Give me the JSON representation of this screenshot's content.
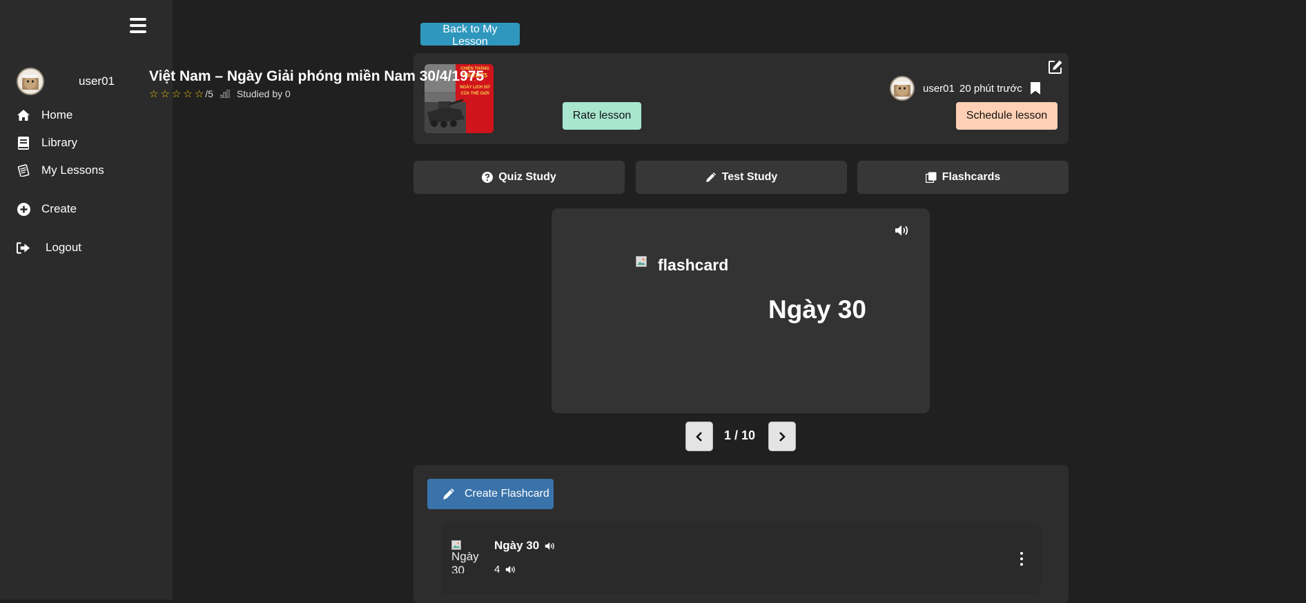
{
  "sidebar": {
    "username": "user01",
    "items": [
      {
        "label": "Home",
        "icon": "home-icon"
      },
      {
        "label": "Library",
        "icon": "book-icon"
      },
      {
        "label": "My Lessons",
        "icon": "notepad-icon"
      },
      {
        "label": "Create",
        "icon": "plus-circle-icon"
      },
      {
        "label": "Logout",
        "icon": "logout-icon"
      }
    ]
  },
  "back_button_label": "Back to My Lesson",
  "lesson": {
    "title": "Việt Nam – Ngày Giải phóng miền Nam 30/4/1975",
    "rating_max": "/5",
    "rating_value": 0,
    "studied": "Studied by 0",
    "rate_label": "Rate lesson",
    "schedule_label": "Schedule lesson",
    "owner": "user01",
    "time_ago": "20 phút trước",
    "thumbnail_lines": [
      "CHIẾN THẮNG",
      "30/4/1975",
      "-",
      "NGÀY LỊCH SỬ",
      "CỦA THẾ GIỚI"
    ]
  },
  "modes": [
    {
      "label": "Quiz Study",
      "icon": "question-circle-icon"
    },
    {
      "label": "Test Study",
      "icon": "pencil-icon"
    },
    {
      "label": "Flashcards",
      "icon": "cards-icon"
    }
  ],
  "flashcard": {
    "image_alt": "flashcard",
    "term": "Ngày 30",
    "counter": "1 / 10"
  },
  "create_flashcard_label": "Create Flashcard",
  "flashcard_list": [
    {
      "image_alt": "Ngày 30",
      "term": "Ngày 30",
      "definition": "4"
    }
  ],
  "colors": {
    "sidebar_bg": "#2b2b2b",
    "page_bg": "#202020",
    "back_button": "#2f97bd",
    "rate_button": "#a8e6cf",
    "schedule_button": "#ffd0b5",
    "create_button": "#3a72aa",
    "star": "#f2c40f"
  }
}
